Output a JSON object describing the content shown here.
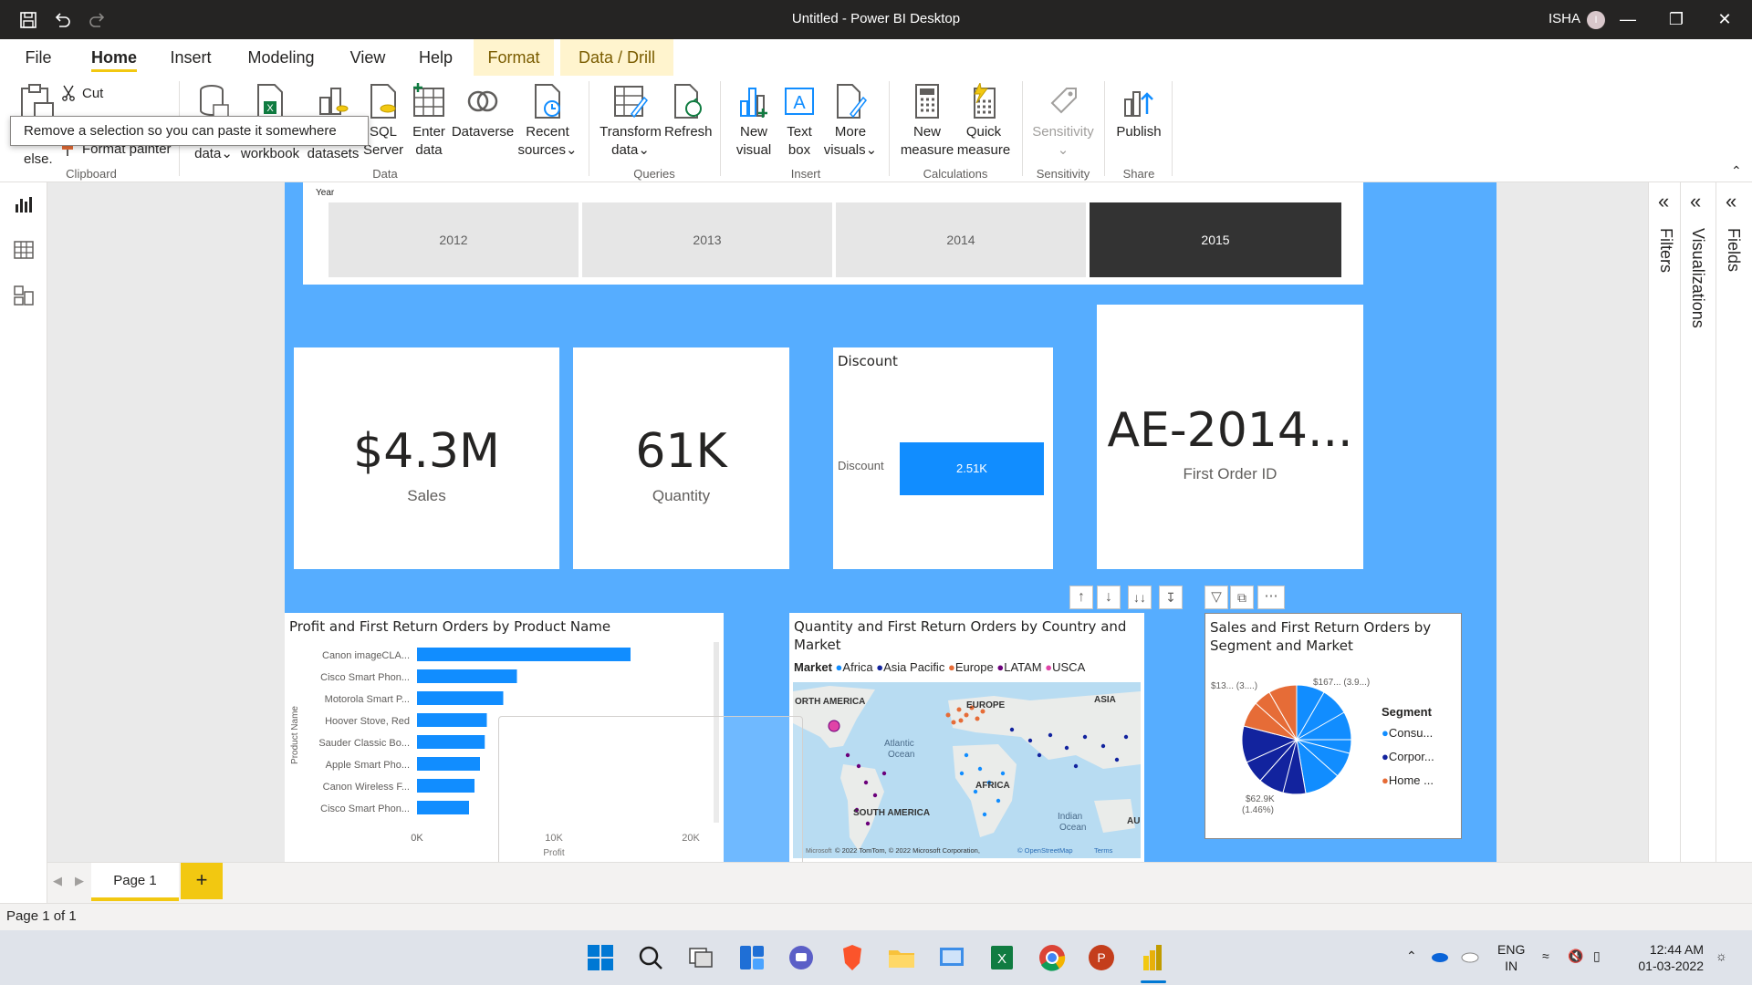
{
  "window": {
    "title": "Untitled - Power BI Desktop",
    "user": "ISHA",
    "avatar_initial": "I"
  },
  "ribbon_tabs": [
    "File",
    "Home",
    "Insert",
    "Modeling",
    "View",
    "Help",
    "Format",
    "Data / Drill"
  ],
  "ribbon": {
    "clipboard": {
      "cut": "Cut",
      "format_painter": "Format painter",
      "group": "Clipboard"
    },
    "data": {
      "get_data": "data",
      "excel": "workbook",
      "datasets": "datasets",
      "sql": "SQL Server",
      "sql_short": "SQL",
      "sql_line2": "Server",
      "enter": "Enter",
      "enter_line2": "data",
      "dataverse": "Dataverse",
      "recent": "Recent",
      "recent_line2": "sources",
      "group": "Data"
    },
    "queries": {
      "transform": "Transform",
      "transform_line2": "data",
      "refresh": "Refresh",
      "group": "Queries"
    },
    "insert": {
      "new_visual": "New",
      "new_visual_line2": "visual",
      "text_box": "Text",
      "text_box_line2": "box",
      "more": "More",
      "more_line2": "visuals",
      "group": "Insert"
    },
    "calculations": {
      "new_measure": "New",
      "new_measure_line2": "measure",
      "quick": "Quick",
      "quick_line2": "measure",
      "group": "Calculations"
    },
    "sensitivity": {
      "label": "Sensitivity",
      "group": "Sensitivity"
    },
    "share": {
      "publish": "Publish",
      "group": "Share"
    },
    "tooltip": "Remove a selection so you can paste it somewhere else."
  },
  "slicer": {
    "label": "Year",
    "items": [
      "2012",
      "2013",
      "2014",
      "2015"
    ],
    "selected": "2015"
  },
  "cards": [
    {
      "value": "$4.3M",
      "label": "Sales"
    },
    {
      "value": "61K",
      "label": "Quantity"
    },
    {
      "value": "AE-2014...",
      "label": "First Order ID"
    }
  ],
  "discount": {
    "title": "Discount",
    "row_label": "Discount",
    "value": "2.51K"
  },
  "bar_visual": {
    "title": "Profit and First Return Orders by Product Name",
    "y_axis_label": "Product Name",
    "x_axis_label": "Profit",
    "ticks": [
      "0K",
      "10K",
      "20K"
    ]
  },
  "chart_data": {
    "type": "bar",
    "title": "Profit and First Return Orders by Product Name",
    "ylabel": "Product Name",
    "xlabel": "Profit",
    "categories": [
      "Canon imageCLA...",
      "Cisco Smart Phon...",
      "Motorola Smart P...",
      "Hoover Stove, Red",
      "Sauder Classic Bo...",
      "Apple Smart Pho...",
      "Canon Wireless F...",
      "Cisco Smart Phon..."
    ],
    "values": [
      15600,
      7300,
      6300,
      5100,
      4950,
      4600,
      4200,
      3800
    ],
    "xlim": [
      0,
      20000
    ],
    "color": "#118dff"
  },
  "map_visual": {
    "title_line1": "Quantity and First Return Orders by Country and",
    "title_line2": "Market",
    "legend_title": "Market",
    "legend": [
      {
        "name": "Africa",
        "color": "#118dff"
      },
      {
        "name": "Asia Pacific",
        "color": "#12239e"
      },
      {
        "name": "Europe",
        "color": "#e66c37"
      },
      {
        "name": "LATAM",
        "color": "#6b007b"
      },
      {
        "name": "USCA",
        "color": "#e044a7"
      }
    ],
    "labels": [
      "ORTH AMERICA",
      "EUROPE",
      "ASIA",
      "Atlantic",
      "Ocean",
      "AFRICA",
      "SOUTH AMERICA",
      "Indian",
      "Ocean",
      "AU"
    ],
    "credits": "© 2022 TomTom, © 2022 Microsoft Corporation,",
    "credits_link": "© OpenStreetMap",
    "terms": "Terms",
    "bing": "Microsoft"
  },
  "pie_visual": {
    "title_line1": "Sales and First Return Orders by",
    "title_line2": "Segment and Market",
    "legend_title": "Segment",
    "legend": [
      {
        "name": "Consu...",
        "color": "#118dff"
      },
      {
        "name": "Corpor...",
        "color": "#12239e"
      },
      {
        "name": "Home ...",
        "color": "#e66c37"
      }
    ],
    "label_top_left": "$13... (3....)",
    "label_top_right": "$167... (3.9...)",
    "label_bottom_value": "$62.9K",
    "label_bottom_pct": "(1.46%)"
  },
  "pages": {
    "tab": "Page 1",
    "add": "+"
  },
  "status": "Page 1 of 1",
  "panes": [
    "Filters",
    "Visualizations",
    "Fields"
  ],
  "taskbar": {
    "lang1": "ENG",
    "lang2": "IN",
    "time": "12:44 AM",
    "date": "01-03-2022"
  }
}
